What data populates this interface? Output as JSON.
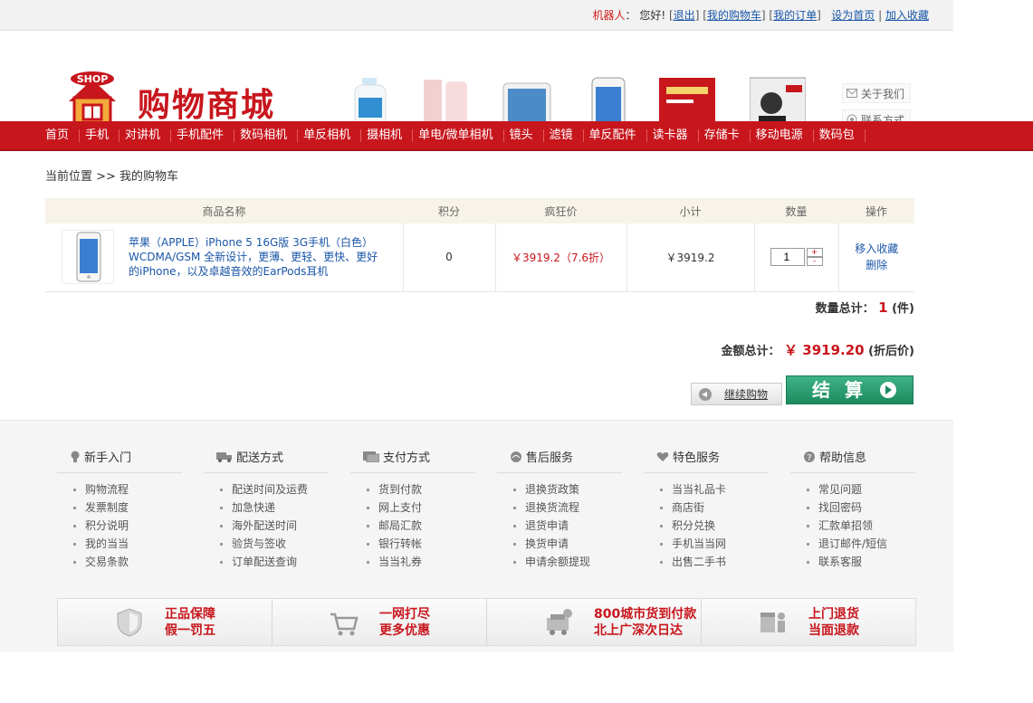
{
  "topbar": {
    "user": "机器人",
    "colon": "：",
    "greeting": "您好!",
    "logout": "退出",
    "my_cart": "我的购物车",
    "my_orders": "我的订单",
    "set_home": "设为首页",
    "add_favorite": "加入收藏"
  },
  "header": {
    "logo_text": "SHOP",
    "brand": "购物商城",
    "about": "关于我们",
    "contact": "联系方式"
  },
  "nav": [
    "首页",
    "手机",
    "对讲机",
    "手机配件",
    "数码相机",
    "单反相机",
    "摄相机",
    "单电/微单相机",
    "镜头",
    "滤镜",
    "单反配件",
    "读卡器",
    "存储卡",
    "移动电源",
    "数码包"
  ],
  "breadcrumb": "当前位置 >> 我的购物车",
  "cart": {
    "headers": [
      "商品名称",
      "积分",
      "疯狂价",
      "小计",
      "数量",
      "操作"
    ],
    "items": [
      {
        "name": "苹果（APPLE）iPhone 5 16G版 3G手机（白色）WCDMA/GSM 全新设计，更薄、更轻、更快、更好的iPhone，以及卓越音效的EarPods耳机",
        "points": "0",
        "price": "￥3919.2（7.6折）",
        "subtotal": "￥3919.2",
        "qty": "1",
        "plus": "+",
        "minus": "-",
        "op_fav": "移入收藏",
        "op_del": "删除"
      }
    ]
  },
  "totals": {
    "count_label": "数量总计：",
    "count": "1",
    "count_unit": "(件)",
    "amount_label": "金额总计：",
    "amount": "￥ 3919.20",
    "amount_note": "(折后价)"
  },
  "actions": {
    "continue": "继续购物",
    "checkout": "结算"
  },
  "footer": {
    "columns": [
      {
        "title": "新手入门",
        "items": [
          "购物流程",
          "发票制度",
          "积分说明",
          "我的当当",
          "交易条款"
        ]
      },
      {
        "title": "配送方式",
        "items": [
          "配送时间及运费",
          "加急快递",
          "海外配送时间",
          "验货与签收",
          "订单配送查询"
        ]
      },
      {
        "title": "支付方式",
        "items": [
          "货到付款",
          "网上支付",
          "邮局汇款",
          "银行转帐",
          "当当礼券"
        ]
      },
      {
        "title": "售后服务",
        "items": [
          "退换货政策",
          "退换货流程",
          "退货申请",
          "换货申请",
          "申请余额提现"
        ]
      },
      {
        "title": "特色服务",
        "items": [
          "当当礼品卡",
          "商店街",
          "积分兑换",
          "手机当当网",
          "出售二手书"
        ]
      },
      {
        "title": "帮助信息",
        "items": [
          "常见问题",
          "找回密码",
          "汇款单招领",
          "退订邮件/短信",
          "联系客服"
        ]
      }
    ],
    "guarantees": [
      {
        "line1": "正品保障",
        "line2": "假一罚五"
      },
      {
        "line1": "一网打尽",
        "line2": "更多优惠"
      },
      {
        "line1": "800城市货到付款",
        "line2": "北上广深次日达"
      },
      {
        "line1": "上门退货",
        "line2": "当面退款"
      }
    ]
  },
  "colors": {
    "brand_red": "#c8161d",
    "checkout_green": "#1c8a5f",
    "link_blue": "#1a56a8"
  }
}
